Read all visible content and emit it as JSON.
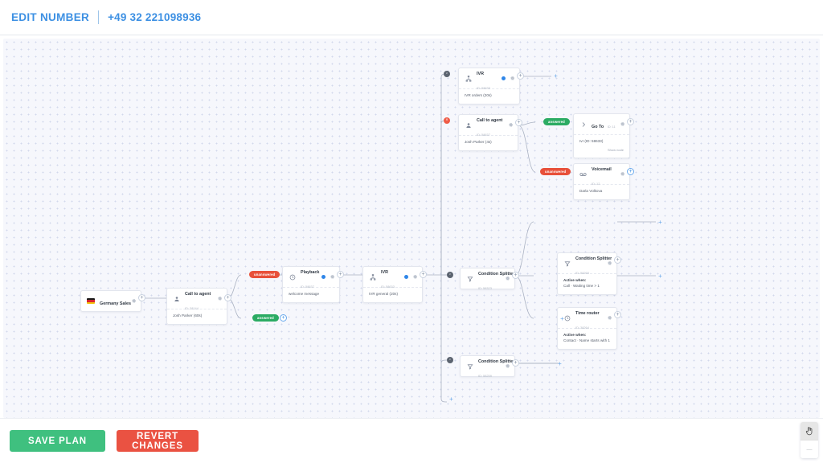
{
  "header": {
    "edit_label": "EDIT NUMBER",
    "phone_number": "+49 32 221098936"
  },
  "footer": {
    "save_label": "SAVE PLAN",
    "revert_label": "REVERT CHANGES"
  },
  "toolbox": {
    "pointer_icon": "hand-pointer-icon",
    "collapse_label": "—"
  },
  "colors": {
    "accent_blue": "#3d90e3",
    "answered_green": "#2bab63",
    "unanswered_red": "#e8503a",
    "save_green": "#3fc07f",
    "revert_red": "#ea5242",
    "canvas_bg": "#f6f7fc"
  },
  "badges": [
    {
      "label": "unanswered",
      "type": "unanswered"
    },
    {
      "label": "answered",
      "type": "answered"
    },
    {
      "label": "answered",
      "type": "answered"
    },
    {
      "label": "unanswered",
      "type": "unanswered"
    }
  ],
  "nodes": {
    "germany_sales": {
      "title": "Germany Sales",
      "icon": "flag-germany-icon"
    },
    "call_to_agent_start": {
      "title": "Call to agent",
      "id": "ID: 38144",
      "icon": "person-icon",
      "body": "Josh Parker (60s)"
    },
    "playback": {
      "title": "Playback",
      "id": "ID: 58637",
      "icon": "clock-icon",
      "body": "welcome message"
    },
    "ivr_general": {
      "title": "IVR",
      "id": "ID: 58633",
      "icon": "sitemap-icon",
      "body": "IVR general (20s)"
    },
    "ivr_orders": {
      "title": "IVR",
      "id": "ID: 58635",
      "icon": "sitemap-icon",
      "body": "IVR orders (20s)"
    },
    "call_to_agent_error": {
      "title": "Call to agent",
      "id": "ID: 58637",
      "icon": "person-icon",
      "body": "Josh Parker (4s)"
    },
    "go_to": {
      "title": "Go To",
      "id": "ID: 11",
      "icon": "chevron-right-icon",
      "body": "Ivr (ID: 58633)",
      "link_label": "Show node"
    },
    "voicemail": {
      "title": "Voicemail",
      "id": "ID: 12",
      "icon": "voicemail-icon",
      "body": "Darla Volkova"
    },
    "condition_splitter_top": {
      "title": "Condition Splitter",
      "id": "ID: 58265",
      "icon": "filter-icon",
      "body_label": "Active when:",
      "body": "Call · Waiting time > 1"
    },
    "time_router": {
      "title": "Time router",
      "id": "ID: 38264",
      "icon": "clock-icon",
      "body_label": "Active when:",
      "body": "Contact · Name starts with 1"
    },
    "condition_splitter_mid": {
      "title": "Condition Splitter",
      "id": "ID: 58323",
      "icon": "filter-icon"
    },
    "condition_splitter_bottom": {
      "title": "Condition Splitter",
      "id": "ID: 58259",
      "icon": "filter-icon"
    }
  }
}
